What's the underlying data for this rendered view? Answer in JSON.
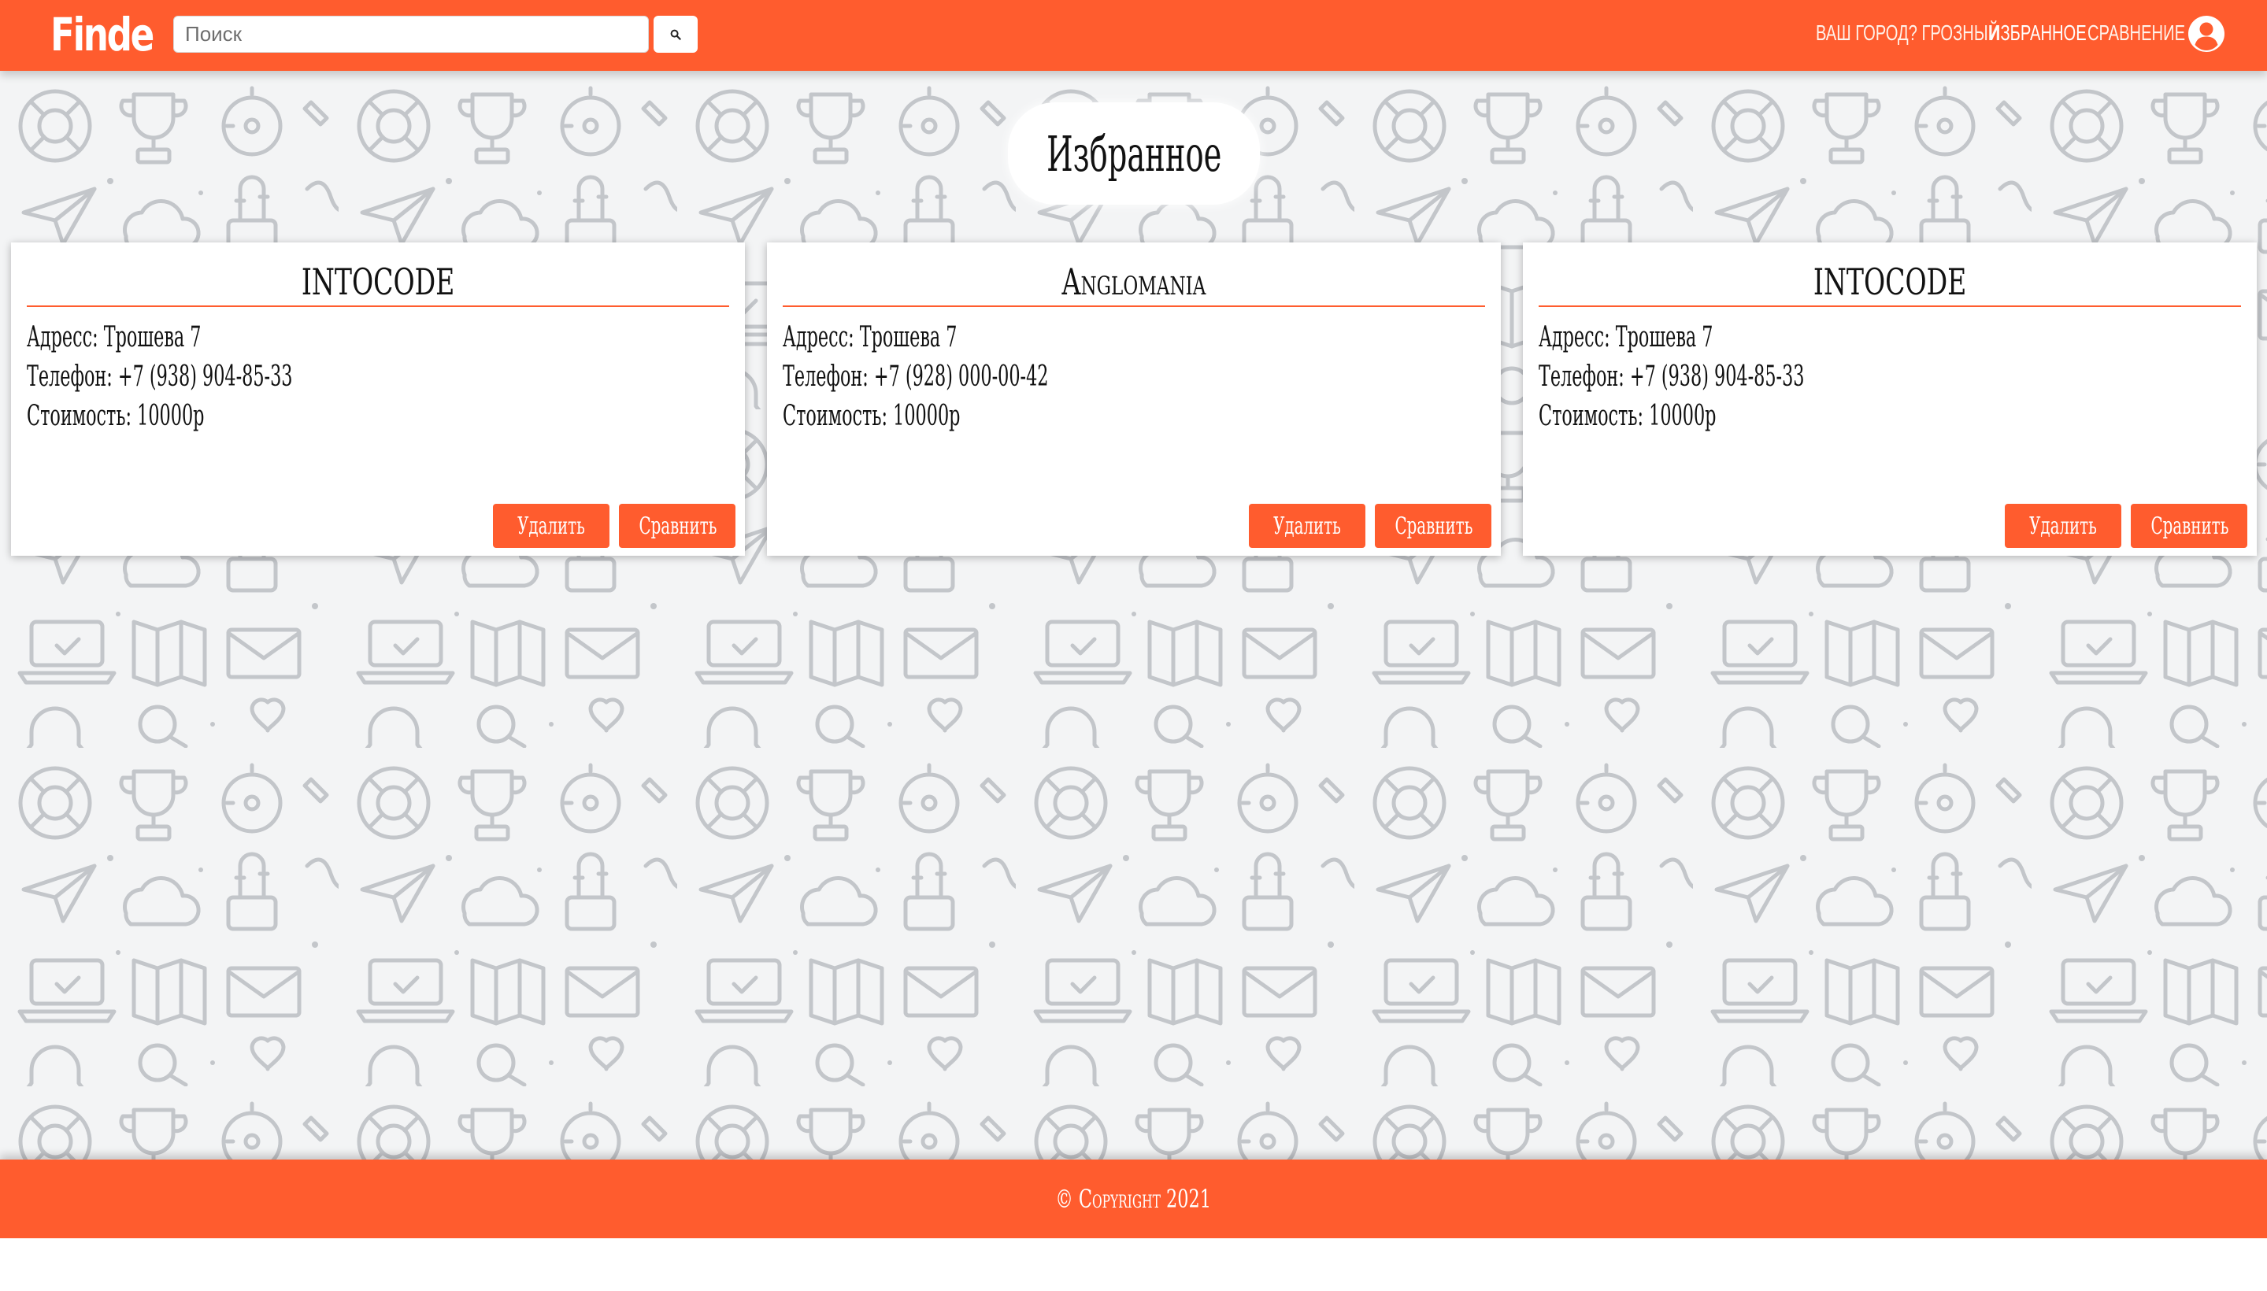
{
  "header": {
    "logo": "Finde",
    "search": {
      "placeholder": "Поиск",
      "value": ""
    },
    "nav": {
      "city": "ВАШ ГОРОД? ГРОЗНЫЙ",
      "favorites": "ИЗБРАННОЕ",
      "compare": "СРАВНЕНИЕ"
    }
  },
  "main": {
    "title": "Избранное",
    "cards": [
      {
        "name": "INTOCODE",
        "address": "Адресс: Трошева 7",
        "phone": "Телефон: +7 (938) 904-85-33",
        "price": "Стоимость: 10000р",
        "delete_label": "Удалить",
        "compare_label": "Сравнить"
      },
      {
        "name": "Anglomania",
        "address": "Адресс: Трошева 7",
        "phone": "Телефон: +7 (928) 000-00-42",
        "price": "Стоимость: 10000р",
        "delete_label": "Удалить",
        "compare_label": "Сравнить"
      },
      {
        "name": "INTOCODE",
        "address": "Адресс: Трошева 7",
        "phone": "Телефон: +7 (938) 904-85-33",
        "price": "Стоимость: 10000р",
        "delete_label": "Удалить",
        "compare_label": "Сравнить"
      }
    ]
  },
  "footer": {
    "text": "© Copyright 2021"
  },
  "colors": {
    "accent": "#ff5c2e",
    "background": "#f3f4f5",
    "pattern": "#c3c6ca",
    "card": "#ffffff",
    "text": "#111111"
  },
  "icons": {
    "search": "search-icon",
    "user": "user-circle-icon"
  }
}
